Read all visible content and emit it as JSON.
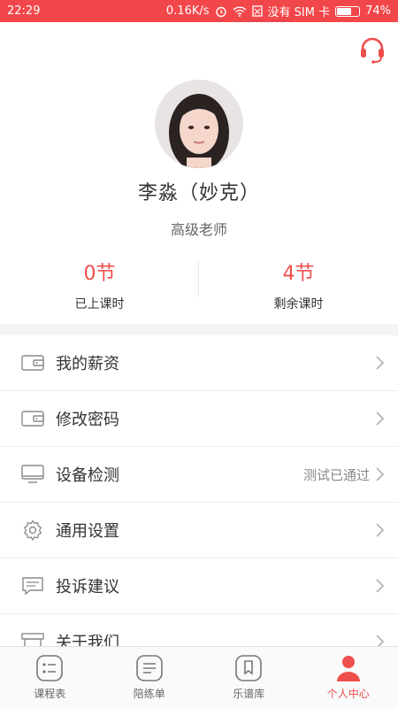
{
  "status_bar": {
    "time": "22:29",
    "network_speed": "0.16K/s",
    "sim": "没有 SIM 卡",
    "battery": "74%",
    "battery_level": 0.74
  },
  "profile": {
    "name": "李淼（妙克）",
    "title": "高级老师"
  },
  "stats": [
    {
      "value": "0节",
      "label": "已上课时"
    },
    {
      "value": "4节",
      "label": "剩余课时"
    }
  ],
  "menu": [
    {
      "label": "我的薪资",
      "icon": "wallet-icon"
    },
    {
      "label": "修改密码",
      "icon": "wallet-icon"
    },
    {
      "label": "设备检测",
      "icon": "monitor-icon",
      "status": "测试已通过"
    },
    {
      "label": "通用设置",
      "icon": "gear-icon"
    },
    {
      "label": "投诉建议",
      "icon": "message-icon"
    },
    {
      "label": "关于我们",
      "icon": "info-board-icon"
    }
  ],
  "tabs": [
    {
      "label": "课程表",
      "icon": "schedule-icon",
      "active": false
    },
    {
      "label": "陪练单",
      "icon": "order-icon",
      "active": false
    },
    {
      "label": "乐谱库",
      "icon": "score-library-icon",
      "active": false
    },
    {
      "label": "个人中心",
      "icon": "person-icon",
      "active": true
    }
  ],
  "colors": {
    "accent": "#ef4f4c",
    "status_bar": "#f2474a"
  }
}
